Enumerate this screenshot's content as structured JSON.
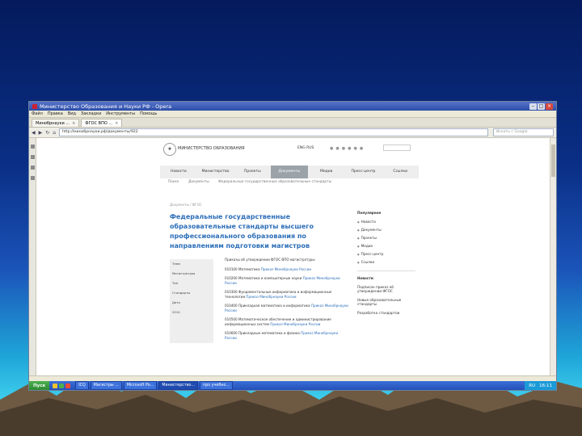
{
  "window": {
    "title": "Министерство Образования и Науки РФ - Opera"
  },
  "menu": [
    "Файл",
    "Правка",
    "Вид",
    "Закладки",
    "Инструменты",
    "Помощь"
  ],
  "tabs": [
    {
      "label": "Минобрнауки ..."
    },
    {
      "label": "ФГОС ВПО ..."
    }
  ],
  "address": {
    "url": "http://минобрнауки.рф/документы/922",
    "search_placeholder": "Искать с Google"
  },
  "site": {
    "name": "МИНИСТЕРСТВО ОБРАЗОВАНИЯ",
    "top_links": "ENG  RUS",
    "nav": [
      {
        "label": "Новости"
      },
      {
        "label": "Министерство"
      },
      {
        "label": "Проекты"
      },
      {
        "label": "Документы"
      },
      {
        "label": "Медиа"
      },
      {
        "label": "Пресс-центр"
      },
      {
        "label": "Ссылки"
      }
    ],
    "subnav": [
      "Поиск",
      "Документы",
      "Федеральные государственные образовательные стандарты"
    ],
    "crumb": "Документы / ФГОС",
    "headline": "Федеральные государственные образовательные стандарты высшего профессионального образования по направлениям подготовки магистров",
    "left_box": [
      "Тема",
      "Магистратура",
      "Тип",
      "Стандарты",
      "Дата",
      "2010"
    ],
    "content_heading": "Приказы об утверждении ФГОС ВПО магистратуры",
    "items": [
      {
        "code": "010100",
        "text": "Математика",
        "link": "Приказ Минобрнауки России"
      },
      {
        "code": "010200",
        "text": "Математика и компьютерные науки",
        "link": "Приказ Минобрнауки России"
      },
      {
        "code": "010300",
        "text": "Фундаментальные информатика и информационные технологии",
        "link": "Приказ Минобрнауки России"
      },
      {
        "code": "010400",
        "text": "Прикладная математика и информатика",
        "link": "Приказ Минобрнауки России"
      },
      {
        "code": "010500",
        "text": "Математическое обеспечение и администрирование информационных систем",
        "link": "Приказ Минобрнауки России"
      },
      {
        "code": "010600",
        "text": "Прикладные математика и физика",
        "link": "Приказ Минобрнауки России"
      }
    ],
    "right_heading": "Популярное",
    "right_items": [
      "Новости",
      "Документы",
      "Проекты",
      "Медиа",
      "Пресс-центр",
      "Ссылки"
    ],
    "right_news_heading": "Новости",
    "right_news": [
      {
        "title": "Подписан приказ об утверждении ФГОС",
        "date": ""
      },
      {
        "title": "Новые образовательные стандарты",
        "date": ""
      },
      {
        "title": "Разработка стандартов",
        "date": ""
      }
    ]
  },
  "taskbar": {
    "start": "Пуск",
    "buttons": [
      {
        "label": "ICQ"
      },
      {
        "label": "Магистры ..."
      },
      {
        "label": "Microsoft Po..."
      },
      {
        "label": "Министерство..."
      },
      {
        "label": "про учебно..."
      }
    ],
    "clock": "16:11",
    "lang": "RU"
  }
}
